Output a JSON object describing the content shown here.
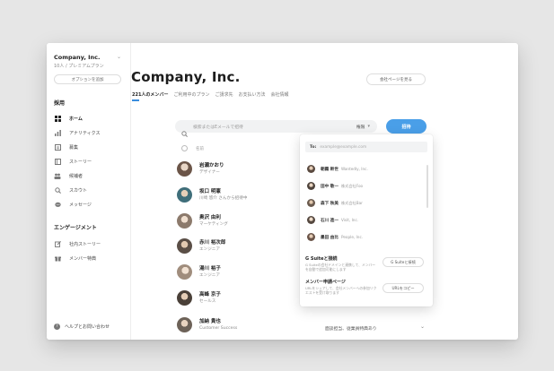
{
  "sidebar": {
    "org_name": "Company, Inc.",
    "org_sub": "10人 / プレミアムプラン",
    "add_option_label": "オプションを追加",
    "section_hiring": "採用",
    "items": [
      {
        "label": "ホーム",
        "icon": "grid-icon"
      },
      {
        "label": "アナリティクス",
        "icon": "bar-chart-icon"
      },
      {
        "label": "募集",
        "icon": "document-icon"
      },
      {
        "label": "ストーリー",
        "icon": "story-icon"
      },
      {
        "label": "候補者",
        "icon": "people-icon"
      },
      {
        "label": "スカウト",
        "icon": "search-icon"
      },
      {
        "label": "メッセージ",
        "icon": "chat-icon"
      }
    ],
    "section_engagement": "エンゲージメント",
    "engagement_items": [
      {
        "label": "社内ストーリー",
        "icon": "edit-icon"
      },
      {
        "label": "メンバー特典",
        "icon": "gift-icon"
      }
    ],
    "help_label": "ヘルプとお問い合わせ"
  },
  "main": {
    "title": "Company, Inc.",
    "company_page_button": "会社ページを見る",
    "tabs": [
      {
        "label": "221人のメンバー",
        "active": true
      },
      {
        "label": "ご利用中のプラン"
      },
      {
        "label": "ご請求先"
      },
      {
        "label": "お支払い方法"
      },
      {
        "label": "会社情報"
      }
    ],
    "search_placeholder": "検索またはEメールで招待",
    "role_select": "権限",
    "invite_button": "招待",
    "list_header": "名前",
    "members": [
      {
        "name": "岩瀬かおり",
        "role": "デザイナー",
        "color": "#6b5548"
      },
      {
        "name": "坂口 明憲",
        "role": "川崎 悠介 さんから招待中",
        "color": "#3f6e7a"
      },
      {
        "name": "奥沢 由利",
        "role": "マーケティング",
        "color": "#8c7a6c"
      },
      {
        "name": "赤川 裕次郎",
        "role": "エンジニア",
        "color": "#5a4e46"
      },
      {
        "name": "湯川 裕子",
        "role": "エンジニア",
        "color": "#a08d7d"
      },
      {
        "name": "高峰 京子",
        "role": "セールス",
        "color": "#4a4038"
      },
      {
        "name": "加納 貴也",
        "role": "Customer Success",
        "color": "#6d6258"
      }
    ],
    "last_member_meta": "面談担当、従業員特典あり"
  },
  "invite_popup": {
    "to_label": "To:",
    "to_placeholder": "example@example.com",
    "suggestions": [
      {
        "name": "朝霧 幹世",
        "company": "Wantedly, Inc."
      },
      {
        "name": "田中 敬一",
        "company": "株式会社Foo"
      },
      {
        "name": "森下 秋美",
        "company": "株式会社Bar"
      },
      {
        "name": "石川 進一",
        "company": "Visit, Inc."
      },
      {
        "name": "墨田 由比",
        "company": "People, Inc."
      }
    ],
    "gsuite_title": "G Suiteと接続",
    "gsuite_desc": "G Suiteの会社ドメインと連携して、メンバーを自動で追加可能にします",
    "gsuite_button": "G Suiteと接続",
    "request_title": "メンバー申請ページ",
    "request_desc": "URLをシェアして、会社メンバーへの参加リクエストを受け取ります",
    "copy_url_button": "URLをコピー"
  },
  "colors": {
    "accent": "#4a9fe8",
    "background": "#e6e6e6"
  }
}
